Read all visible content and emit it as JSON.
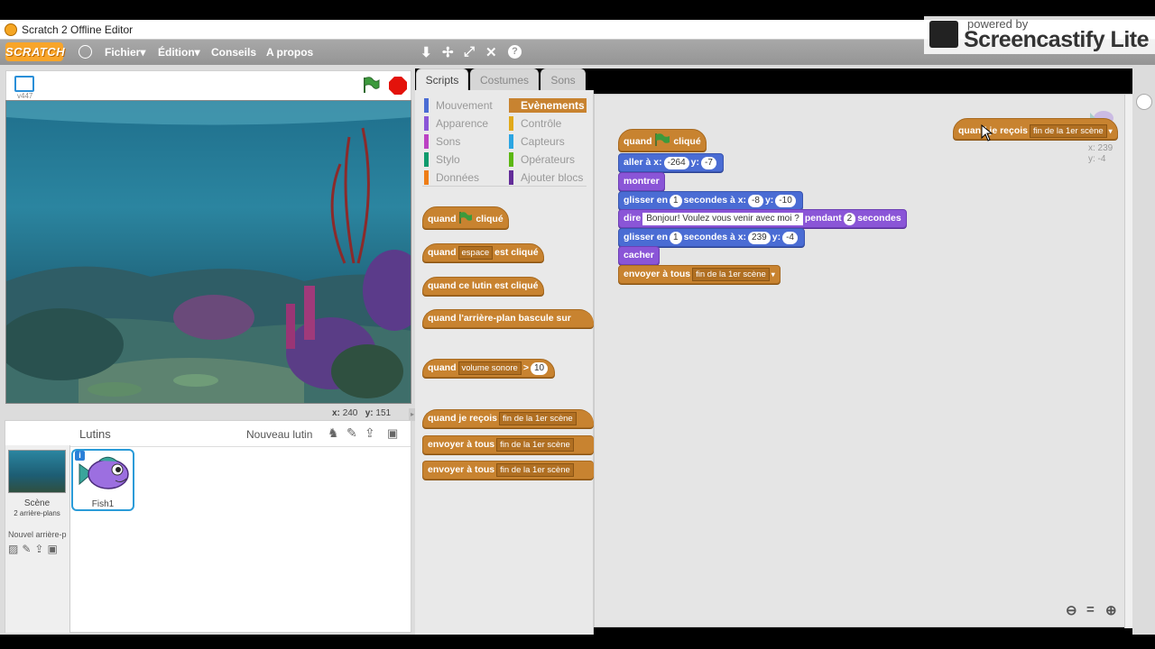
{
  "window": {
    "title": "Scratch 2 Offline Editor"
  },
  "menu": {
    "logo": "SCRATCH",
    "items": [
      {
        "label": "Fichier",
        "caret": "▾"
      },
      {
        "label": "Édition",
        "caret": "▾"
      },
      {
        "label": "Conseils",
        "caret": ""
      },
      {
        "label": "A propos",
        "caret": ""
      }
    ]
  },
  "overlay": {
    "powered": "powered by",
    "name": "Screencastify Lite"
  },
  "stage": {
    "version": "v447",
    "mouse_x_label": "x:",
    "mouse_x": "240",
    "mouse_y_label": "y:",
    "mouse_y": "151"
  },
  "sprites_panel": {
    "title": "Lutins",
    "new_sprite": "Nouveau lutin",
    "scene_label": "Scène",
    "scene_sub": "2 arrière-plans",
    "new_backdrop": "Nouvel arrière-p",
    "sprite_name": "Fish1"
  },
  "tabs": [
    "Scripts",
    "Costumes",
    "Sons"
  ],
  "categories": {
    "left": [
      {
        "label": "Mouvement",
        "color": "#4a6cd4"
      },
      {
        "label": "Apparence",
        "color": "#8a55d7"
      },
      {
        "label": "Sons",
        "color": "#bb42c3"
      },
      {
        "label": "Stylo",
        "color": "#0e9a6c"
      },
      {
        "label": "Données",
        "color": "#ee7d16"
      }
    ],
    "right": [
      {
        "label": "Evènements",
        "color": "#c88330",
        "active": true
      },
      {
        "label": "Contrôle",
        "color": "#e1a91a"
      },
      {
        "label": "Capteurs",
        "color": "#2ca5e2"
      },
      {
        "label": "Opérateurs",
        "color": "#5cb712"
      },
      {
        "label": "Ajouter blocs",
        "color": "#632d99"
      }
    ]
  },
  "palette": {
    "b1": {
      "pre": "quand",
      "post": "cliqué"
    },
    "b2": {
      "pre": "quand",
      "drop": "espace",
      "post": "est cliqué"
    },
    "b3": {
      "text": "quand ce lutin est cliqué"
    },
    "b4": {
      "text": "quand l'arrière-plan bascule sur"
    },
    "b5": {
      "pre": "quand",
      "drop": "volume sonore",
      "op": ">",
      "val": "10"
    },
    "b6": {
      "pre": "quand je reçois",
      "drop": "fin de la 1er scène"
    },
    "b7": {
      "pre": "envoyer à tous",
      "drop": "fin de la 1er scène"
    },
    "b8": {
      "pre": "envoyer à tous",
      "drop": "fin de la 1er scène"
    }
  },
  "script": {
    "hat": {
      "pre": "quand",
      "post": "cliqué"
    },
    "goto": {
      "label": "aller à x:",
      "x": "-264",
      "ylabel": "y:",
      "y": "-7"
    },
    "show": "montrer",
    "glide1": {
      "label": "glisser en",
      "secs": "1",
      "mid": "secondes à x:",
      "x": "-8",
      "ylabel": "y:",
      "y": "-10"
    },
    "say": {
      "label": "dire",
      "text": "Bonjour! Voulez vous venir avec moi ?",
      "mid": "pendant",
      "secs": "2",
      "post": "secondes"
    },
    "glide2": {
      "label": "glisser en",
      "secs": "1",
      "mid": "secondes à x:",
      "x": "239",
      "ylabel": "y:",
      "y": "-4"
    },
    "hide": "cacher",
    "broadcast": {
      "label": "envoyer à tous",
      "drop": "fin de la 1er scène"
    },
    "receive": {
      "label": "quand je reçois",
      "drop": "fin de la 1er scène"
    },
    "sprite_x": "x: 239",
    "sprite_y": "y: -4"
  },
  "colors": {
    "events": "#c88330",
    "motion": "#4a6cd4",
    "looks": "#8a55d7",
    "accent_tab": "#c88330"
  }
}
